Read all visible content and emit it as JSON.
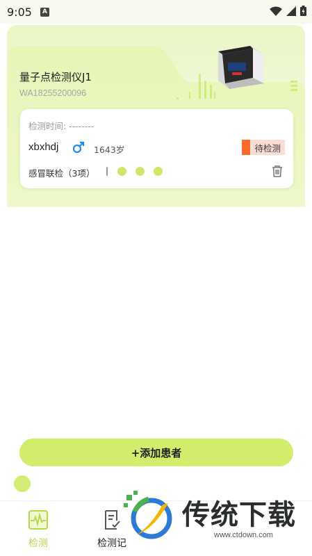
{
  "status_bar": {
    "time": "9:05",
    "badge": "A"
  },
  "device": {
    "name": "量子点检测仪J1",
    "sn": "WA18255200096"
  },
  "card": {
    "test_time": "检测时间: --------",
    "patient_name": "xbxhdj",
    "age": "1643岁",
    "status": "待检测",
    "test_item": "感冒联检（3项）",
    "separator": "|",
    "result_dots": 3
  },
  "actions": {
    "add_patient": "+添加患者"
  },
  "nav": {
    "items": [
      {
        "label": "检测",
        "icon": "waveform-icon",
        "active": true
      },
      {
        "label": "检测记",
        "icon": "report-icon",
        "active": false
      }
    ]
  },
  "watermark": {
    "brand": "传统下载",
    "url": "www.ctdown.com"
  },
  "colors": {
    "accent": "#d2ec6c",
    "nav_active": "#b7d84a",
    "badge_strip": "#fb6a2b",
    "badge_bg": "#f9ddd2",
    "gender_male": "#1e88e5"
  }
}
